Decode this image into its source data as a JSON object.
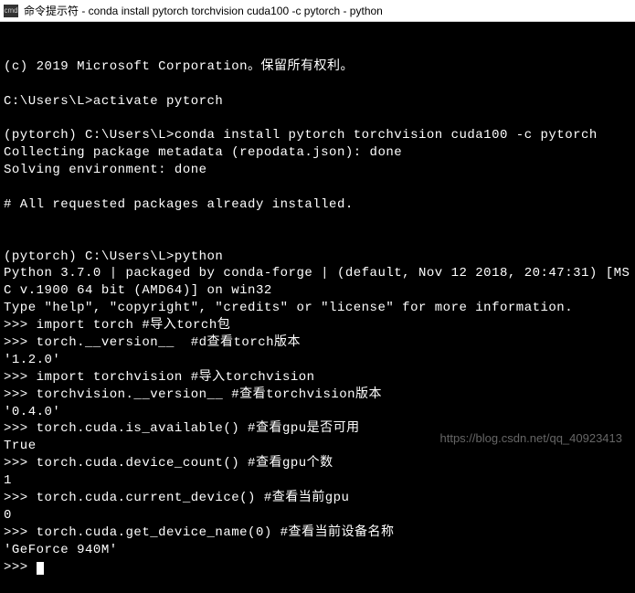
{
  "titlebar": {
    "icon_label": "cmd",
    "title": "命令提示符 - conda  install pytorch torchvision cuda100 -c pytorch - python"
  },
  "terminal": {
    "lines": [
      "(c) 2019 Microsoft Corporation。保留所有权利。",
      "",
      "C:\\Users\\L>activate pytorch",
      "",
      "(pytorch) C:\\Users\\L>conda install pytorch torchvision cuda100 -c pytorch",
      "Collecting package metadata (repodata.json): done",
      "Solving environment: done",
      "",
      "# All requested packages already installed.",
      "",
      "",
      "(pytorch) C:\\Users\\L>python",
      "Python 3.7.0 | packaged by conda-forge | (default, Nov 12 2018, 20:47:31) [MSC v.1900 64 bit (AMD64)] on win32",
      "Type \"help\", \"copyright\", \"credits\" or \"license\" for more information.",
      ">>> import torch #导入torch包",
      ">>> torch.__version__  #d查看torch版本",
      "'1.2.0'",
      ">>> import torchvision #导入torchvision",
      ">>> torchvision.__version__ #查看torchvision版本",
      "'0.4.0'",
      ">>> torch.cuda.is_available() #查看gpu是否可用",
      "True",
      ">>> torch.cuda.device_count() #查看gpu个数",
      "1",
      ">>> torch.cuda.current_device() #查看当前gpu",
      "0",
      ">>> torch.cuda.get_device_name(0) #查看当前设备名称",
      "'GeForce 940M'",
      ">>> "
    ]
  },
  "watermark": "https://blog.csdn.net/qq_40923413"
}
